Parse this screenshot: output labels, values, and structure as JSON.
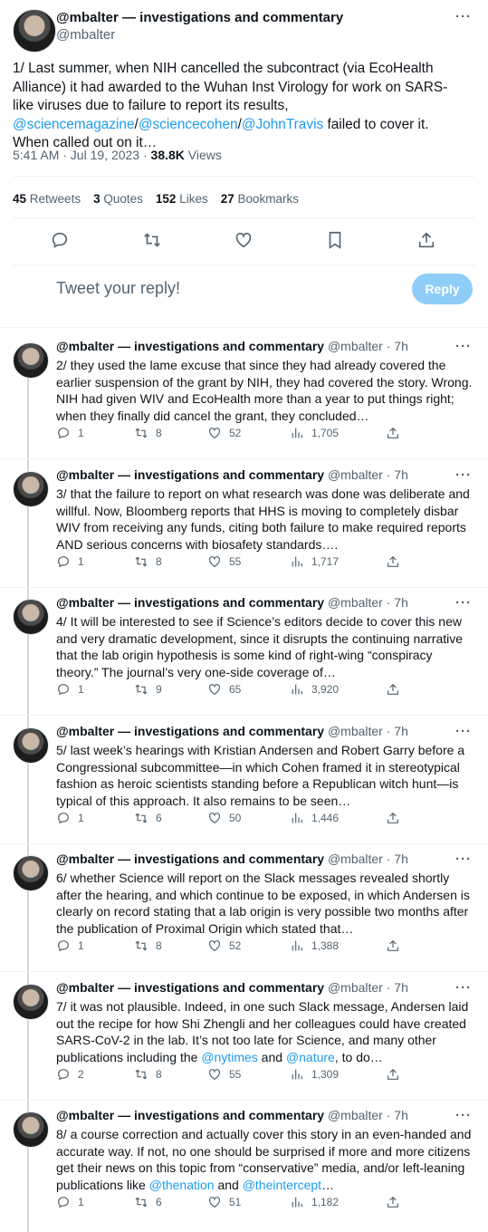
{
  "main": {
    "author": "@mbalter — investigations and commentary",
    "handle": "@mbalter",
    "text_before": "1/ Last summer, when NIH cancelled the subcontract (via EcoHealth Alliance) it had awarded to the Wuhan Inst Virology for work on SARS-like viruses due to failure to report its results, ",
    "mention1": "@sciencemagazine",
    "sep1": "/",
    "mention2": "@sciencecohen",
    "sep2": "/",
    "mention3": "@JohnTravis",
    "text_after": " failed to cover it. When called out on it…",
    "time": "5:41 AM · Jul 19, 2023 · ",
    "views_count": "38.8K",
    "views_label": " Views",
    "retweets_count": "45",
    "retweets_label": "Retweets",
    "quotes_count": "3",
    "quotes_label": "Quotes",
    "likes_count": "152",
    "likes_label": "Likes",
    "bookmarks_count": "27",
    "bookmarks_label": "Bookmarks",
    "reply_placeholder": "Tweet your reply!",
    "reply_button": "Reply"
  },
  "replies": [
    {
      "author": "@mbalter — investigations and commentary",
      "meta": "@mbalter · 7h",
      "text": "2/ they used the lame excuse that since they had already covered the earlier suspension of the grant by NIH, they had covered the story. Wrong. NIH had given WIV and EcoHealth more than a year to put things right; when they finally did cancel the grant, they concluded…",
      "replies": "1",
      "retweets": "8",
      "likes": "52",
      "views": "1,705"
    },
    {
      "author": "@mbalter — investigations and commentary",
      "meta": "@mbalter · 7h",
      "text": "3/ that the failure to report on what research was done was deliberate and willful. Now, Bloomberg reports that HHS is moving to completely disbar WIV from receiving any funds, citing both failure to make required reports AND serious concerns with biosafety standards….",
      "replies": "1",
      "retweets": "8",
      "likes": "55",
      "views": "1,717"
    },
    {
      "author": "@mbalter — investigations and commentary",
      "meta": "@mbalter · 7h",
      "text": "4/ It will be interested to see if Science’s editors decide to cover this new and very dramatic development, since it disrupts the continuing narrative that the lab origin hypothesis is some kind of right-wing “conspiracy theory.” The journal’s very one-side coverage of…",
      "replies": "1",
      "retweets": "9",
      "likes": "65",
      "views": "3,920"
    },
    {
      "author": "@mbalter — investigations and commentary",
      "meta": "@mbalter · 7h",
      "text": "5/ last week’s hearings with Kristian Andersen and Robert Garry before a Congressional subcommittee—in which Cohen framed it in stereotypical fashion as heroic scientists standing before a Republican witch hunt—is typical of this approach. It also remains to be seen…",
      "replies": "1",
      "retweets": "6",
      "likes": "50",
      "views": "1,446"
    },
    {
      "author": "@mbalter — investigations and commentary",
      "meta": "@mbalter · 7h",
      "text": "6/ whether Science will report on the Slack messages revealed shortly after the hearing, and which continue to be exposed, in which Andersen is clearly on record stating that a lab origin is very possible two months after the publication of Proximal Origin which stated that…",
      "replies": "1",
      "retweets": "8",
      "likes": "52",
      "views": "1,388"
    },
    {
      "author": "@mbalter — investigations and commentary",
      "meta": "@mbalter · 7h",
      "text_before": "7/ it was not plausible. Indeed, in one such Slack message, Andersen laid out the recipe for how Shi Zhengli and her colleagues could have created SARS-CoV-2 in the lab. It’s not too late for Science, and many other publications including the ",
      "link1": "@nytimes",
      "mid": " and ",
      "link2": "@nature",
      "text_after": ", to do…",
      "replies": "2",
      "retweets": "8",
      "likes": "55",
      "views": "1,309"
    },
    {
      "author": "@mbalter — investigations and commentary",
      "meta": "@mbalter · 7h",
      "text_before": "8/ a course correction and actually cover this story in an even-handed and accurate way. If not, no one should be surprised if more and more citizens get their news on this topic from “conservative” media, and/or left-leaning publications like ",
      "link1": "@thenation",
      "mid": " and ",
      "link2": "@theintercept",
      "text_after": "…",
      "replies": "1",
      "retweets": "6",
      "likes": "51",
      "views": "1,182"
    }
  ],
  "icons": [
    "more-icon",
    "reply-icon",
    "retweet-icon",
    "like-icon",
    "bookmark-icon",
    "share-icon",
    "views-icon"
  ],
  "colors": {
    "link": "#1d9bf0",
    "muted": "#536471",
    "reply_button": "#8ecdf8"
  }
}
